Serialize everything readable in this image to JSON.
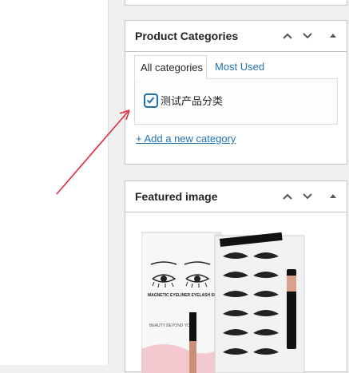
{
  "product_categories": {
    "title": "Product Categories",
    "tabs": [
      {
        "label": "All categories"
      },
      {
        "label": "Most Used"
      }
    ],
    "categories": [
      {
        "label": "测试产品分类",
        "checked": true
      }
    ],
    "add_link": "+ Add a new category"
  },
  "featured_image": {
    "title": "Featured image",
    "box_text": "MAGNETIC EYELINER EYELASH SET",
    "box_text_small": "BEAUTY BEYOND YOU"
  },
  "icons": {
    "move_up": "chevron-up-icon",
    "move_down": "chevron-down-icon",
    "toggle": "triangle-up-icon"
  },
  "colors": {
    "link": "#2271b1",
    "annotation_arrow": "#e0283a"
  }
}
